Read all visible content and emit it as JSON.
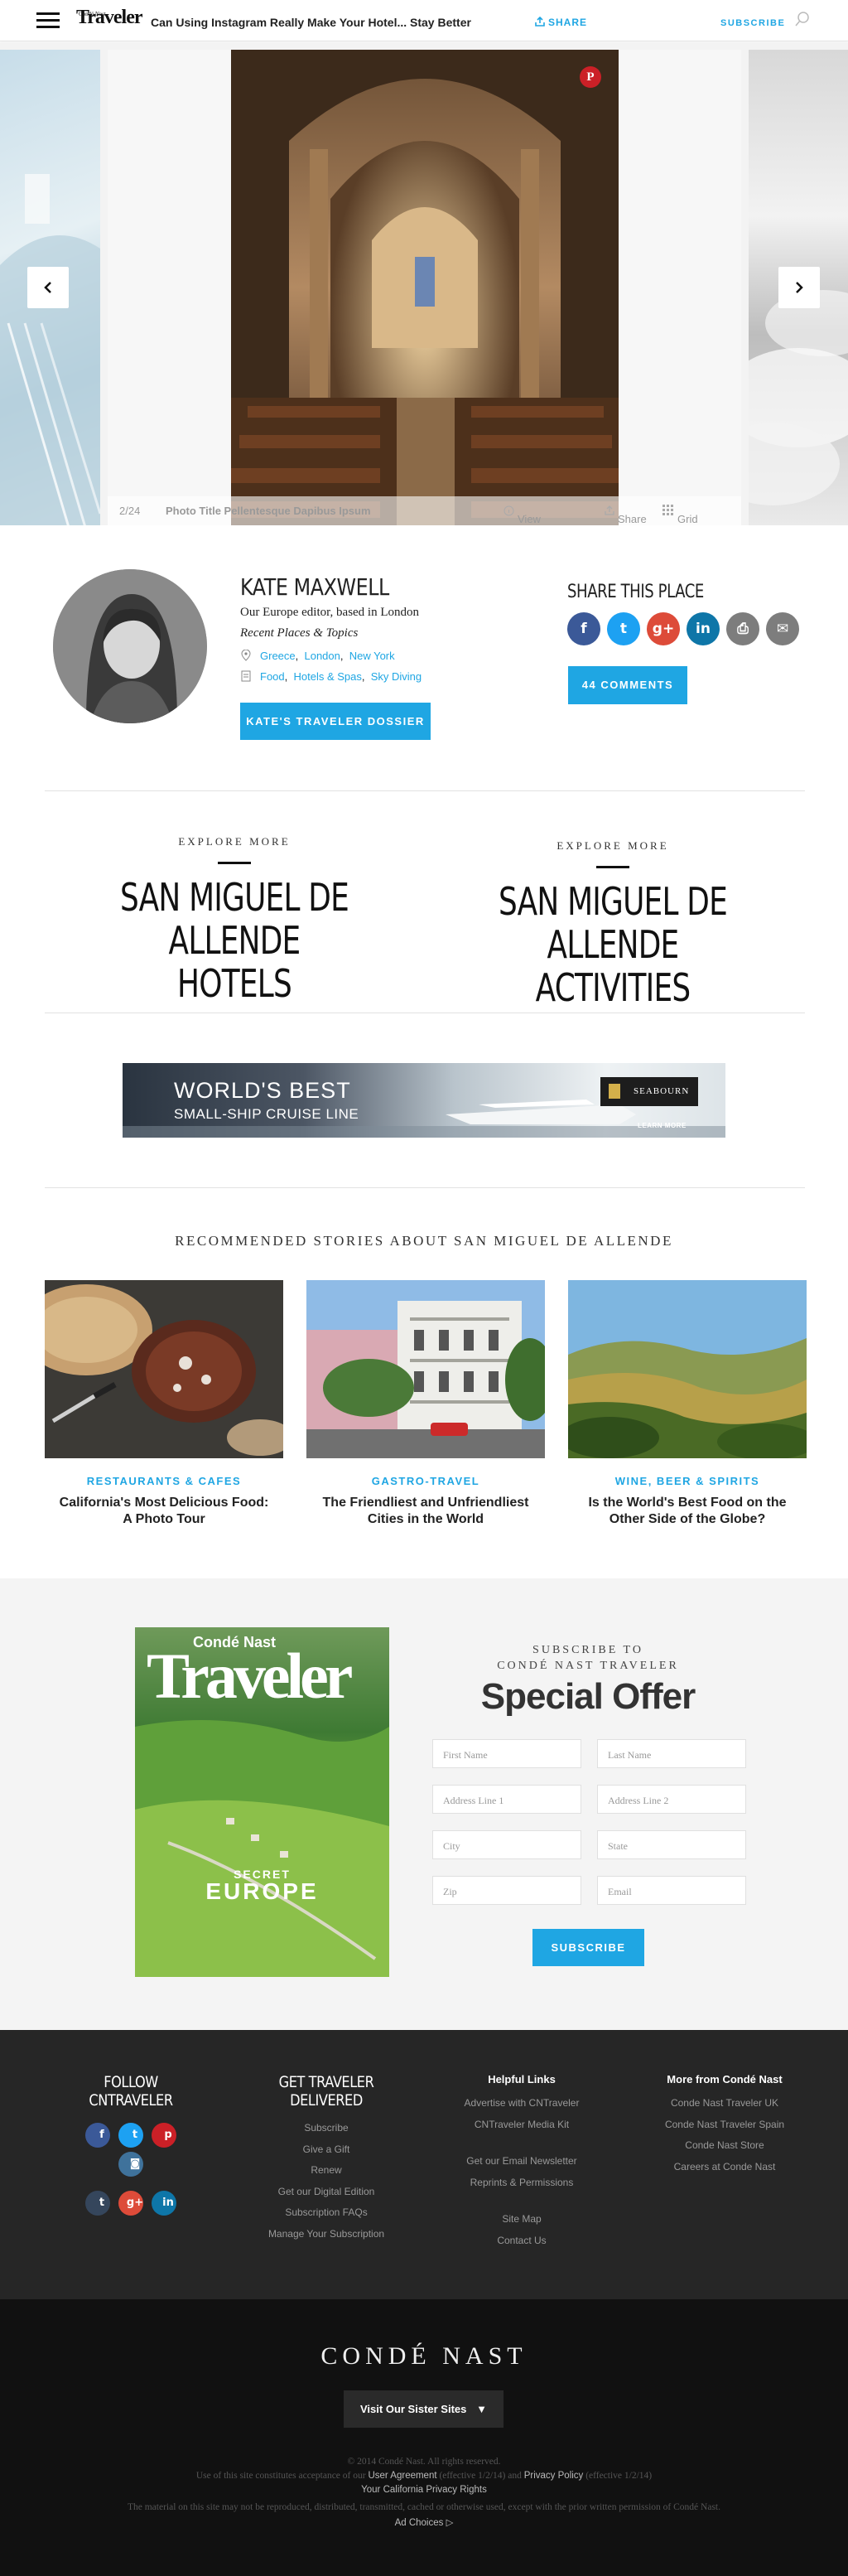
{
  "header": {
    "brand_small": "Condé Nast",
    "brand": "Traveler",
    "article_title": "Can Using Instagram Really Make Your Hotel... Stay Better",
    "share_label": "SHARE",
    "subscribe_label": "SUBSCRIBE",
    "icons": [
      "menu-icon",
      "share-icon",
      "search-icon"
    ]
  },
  "gallery": {
    "counter": "2/24",
    "photo_title": "Photo Title Pellentesque Dapibus Ipsum",
    "view_caption": "View Caption",
    "share": "Share",
    "grid_view": "Grid View",
    "icons": [
      "pinterest-icon",
      "chevron-left-icon",
      "chevron-right-icon"
    ]
  },
  "author": {
    "name": "KATE MAXWELL",
    "role": "Our Europe editor, based in London",
    "recent_label": "Recent Places & Topics",
    "places": [
      "Greece",
      "London",
      "New York"
    ],
    "topics": [
      "Food",
      "Hotels & Spas",
      "Sky Diving"
    ],
    "dossier_button": "KATE'S TRAVELER DOSSIER"
  },
  "share_place": {
    "heading": "SHARE THIS PLACE",
    "networks": [
      {
        "name": "facebook-icon",
        "color": "#3b5998",
        "glyph": "f"
      },
      {
        "name": "twitter-icon",
        "color": "#1da1f2",
        "glyph": "t"
      },
      {
        "name": "google-plus-icon",
        "color": "#dd4b39",
        "glyph": "g+"
      },
      {
        "name": "linkedin-icon",
        "color": "#0e76a8",
        "glyph": "in"
      },
      {
        "name": "print-icon",
        "color": "#7d7d7d",
        "glyph": "⎙"
      },
      {
        "name": "email-icon",
        "color": "#7d7d7d",
        "glyph": "✉"
      }
    ],
    "comments_button": "44 COMMENTS"
  },
  "explore": [
    {
      "kicker": "EXPLORE MORE",
      "title_l1": "SAN MIGUEL DE",
      "title_l2": "ALLENDE HOTELS"
    },
    {
      "kicker": "EXPLORE MORE",
      "title_l1": "SAN MIGUEL DE",
      "title_l2": "ALLENDE ACTIVITIES"
    }
  ],
  "ad": {
    "headline": "WORLD'S BEST",
    "subline": "SMALL-SHIP CRUISE LINE",
    "brand": "SEABOURN",
    "cta": "LEARN MORE"
  },
  "recommended": {
    "heading": "RECOMMENDED STORIES ABOUT SAN MIGUEL DE ALLENDE",
    "stories": [
      {
        "category": "RESTAURANTS & CAFES",
        "title": "California's Most Delicious Food: A Photo Tour"
      },
      {
        "category": "GASTRO-TRAVEL",
        "title": "The Friendliest and Unfriendliest Cities in the World"
      },
      {
        "category": "WINE, BEER & SPIRITS",
        "title": "Is the World's Best Food on the Other Side of the Globe?"
      }
    ]
  },
  "subscribe": {
    "cover_brand_small": "Condé Nast",
    "cover_brand": "Traveler",
    "cover_kicker": "SECRET",
    "cover_headline": "EUROPE",
    "kicker_l1": "SUBSCRIBE TO",
    "kicker_l2": "CONDÉ NAST TRAVELER",
    "heading": "Special Offer",
    "fields": {
      "first_name": "First Name",
      "last_name": "Last Name",
      "address1": "Address Line 1",
      "address2": "Address Line 2",
      "city": "City",
      "state": "State",
      "zip": "Zip",
      "email": "Email"
    },
    "button": "SUBSCRIBE"
  },
  "footer": {
    "follow_l1": "FOLLOW",
    "follow_l2": "CNTRAVELER",
    "social": [
      {
        "name": "facebook-icon",
        "color": "#3b5998",
        "glyph": "f"
      },
      {
        "name": "twitter-icon",
        "color": "#1da1f2",
        "glyph": "t"
      },
      {
        "name": "pinterest-icon",
        "color": "#cb2027",
        "glyph": "p"
      },
      {
        "name": "instagram-icon",
        "color": "#3f729b",
        "glyph": "◙"
      },
      {
        "name": "tumblr-icon",
        "color": "#35465c",
        "glyph": "t"
      },
      {
        "name": "google-plus-icon",
        "color": "#dd4b39",
        "glyph": "g+"
      },
      {
        "name": "linkedin-icon",
        "color": "#0e76a8",
        "glyph": "in"
      }
    ],
    "delivered_l1": "GET TRAVELER",
    "delivered_l2": "DELIVERED",
    "delivered_links": [
      "Subscribe",
      "Give a Gift",
      "Renew",
      "Get our Digital Edition",
      "Subscription FAQs",
      "Manage Your Subscription"
    ],
    "helpful_heading": "Helpful Links",
    "helpful_links_a": [
      "Advertise with CNTraveler",
      "CNTraveler Media Kit"
    ],
    "helpful_links_b": [
      "Get our Email Newsletter",
      "Reprints & Permissions"
    ],
    "helpful_links_c": [
      "Site Map",
      "Contact Us"
    ],
    "more_heading": "More from Condé Nast",
    "more_links": [
      "Conde Nast Traveler UK",
      "Conde Nast Traveler Spain",
      "Conde Nast Store",
      "Careers at Conde Nast"
    ]
  },
  "bottom": {
    "logo": "CONDÉ NAST",
    "sister_button": "Visit Our Sister Sites",
    "copyright": "© 2014 Condé Nast. All rights reserved.",
    "legal_prefix": "Use of this site constitutes acceptance of our",
    "user_agreement": "User Agreement",
    "ua_date": "(effective 1/2/14) and",
    "privacy": "Privacy Policy",
    "pp_date": "(effective 1/2/14)",
    "california": "Your California Privacy Rights",
    "material": "The material on this site may not be reproduced, distributed, transmitted, cached or otherwise used, except with the prior written permission of Condé Nast.",
    "ad_choices": "Ad Choices ▷"
  }
}
